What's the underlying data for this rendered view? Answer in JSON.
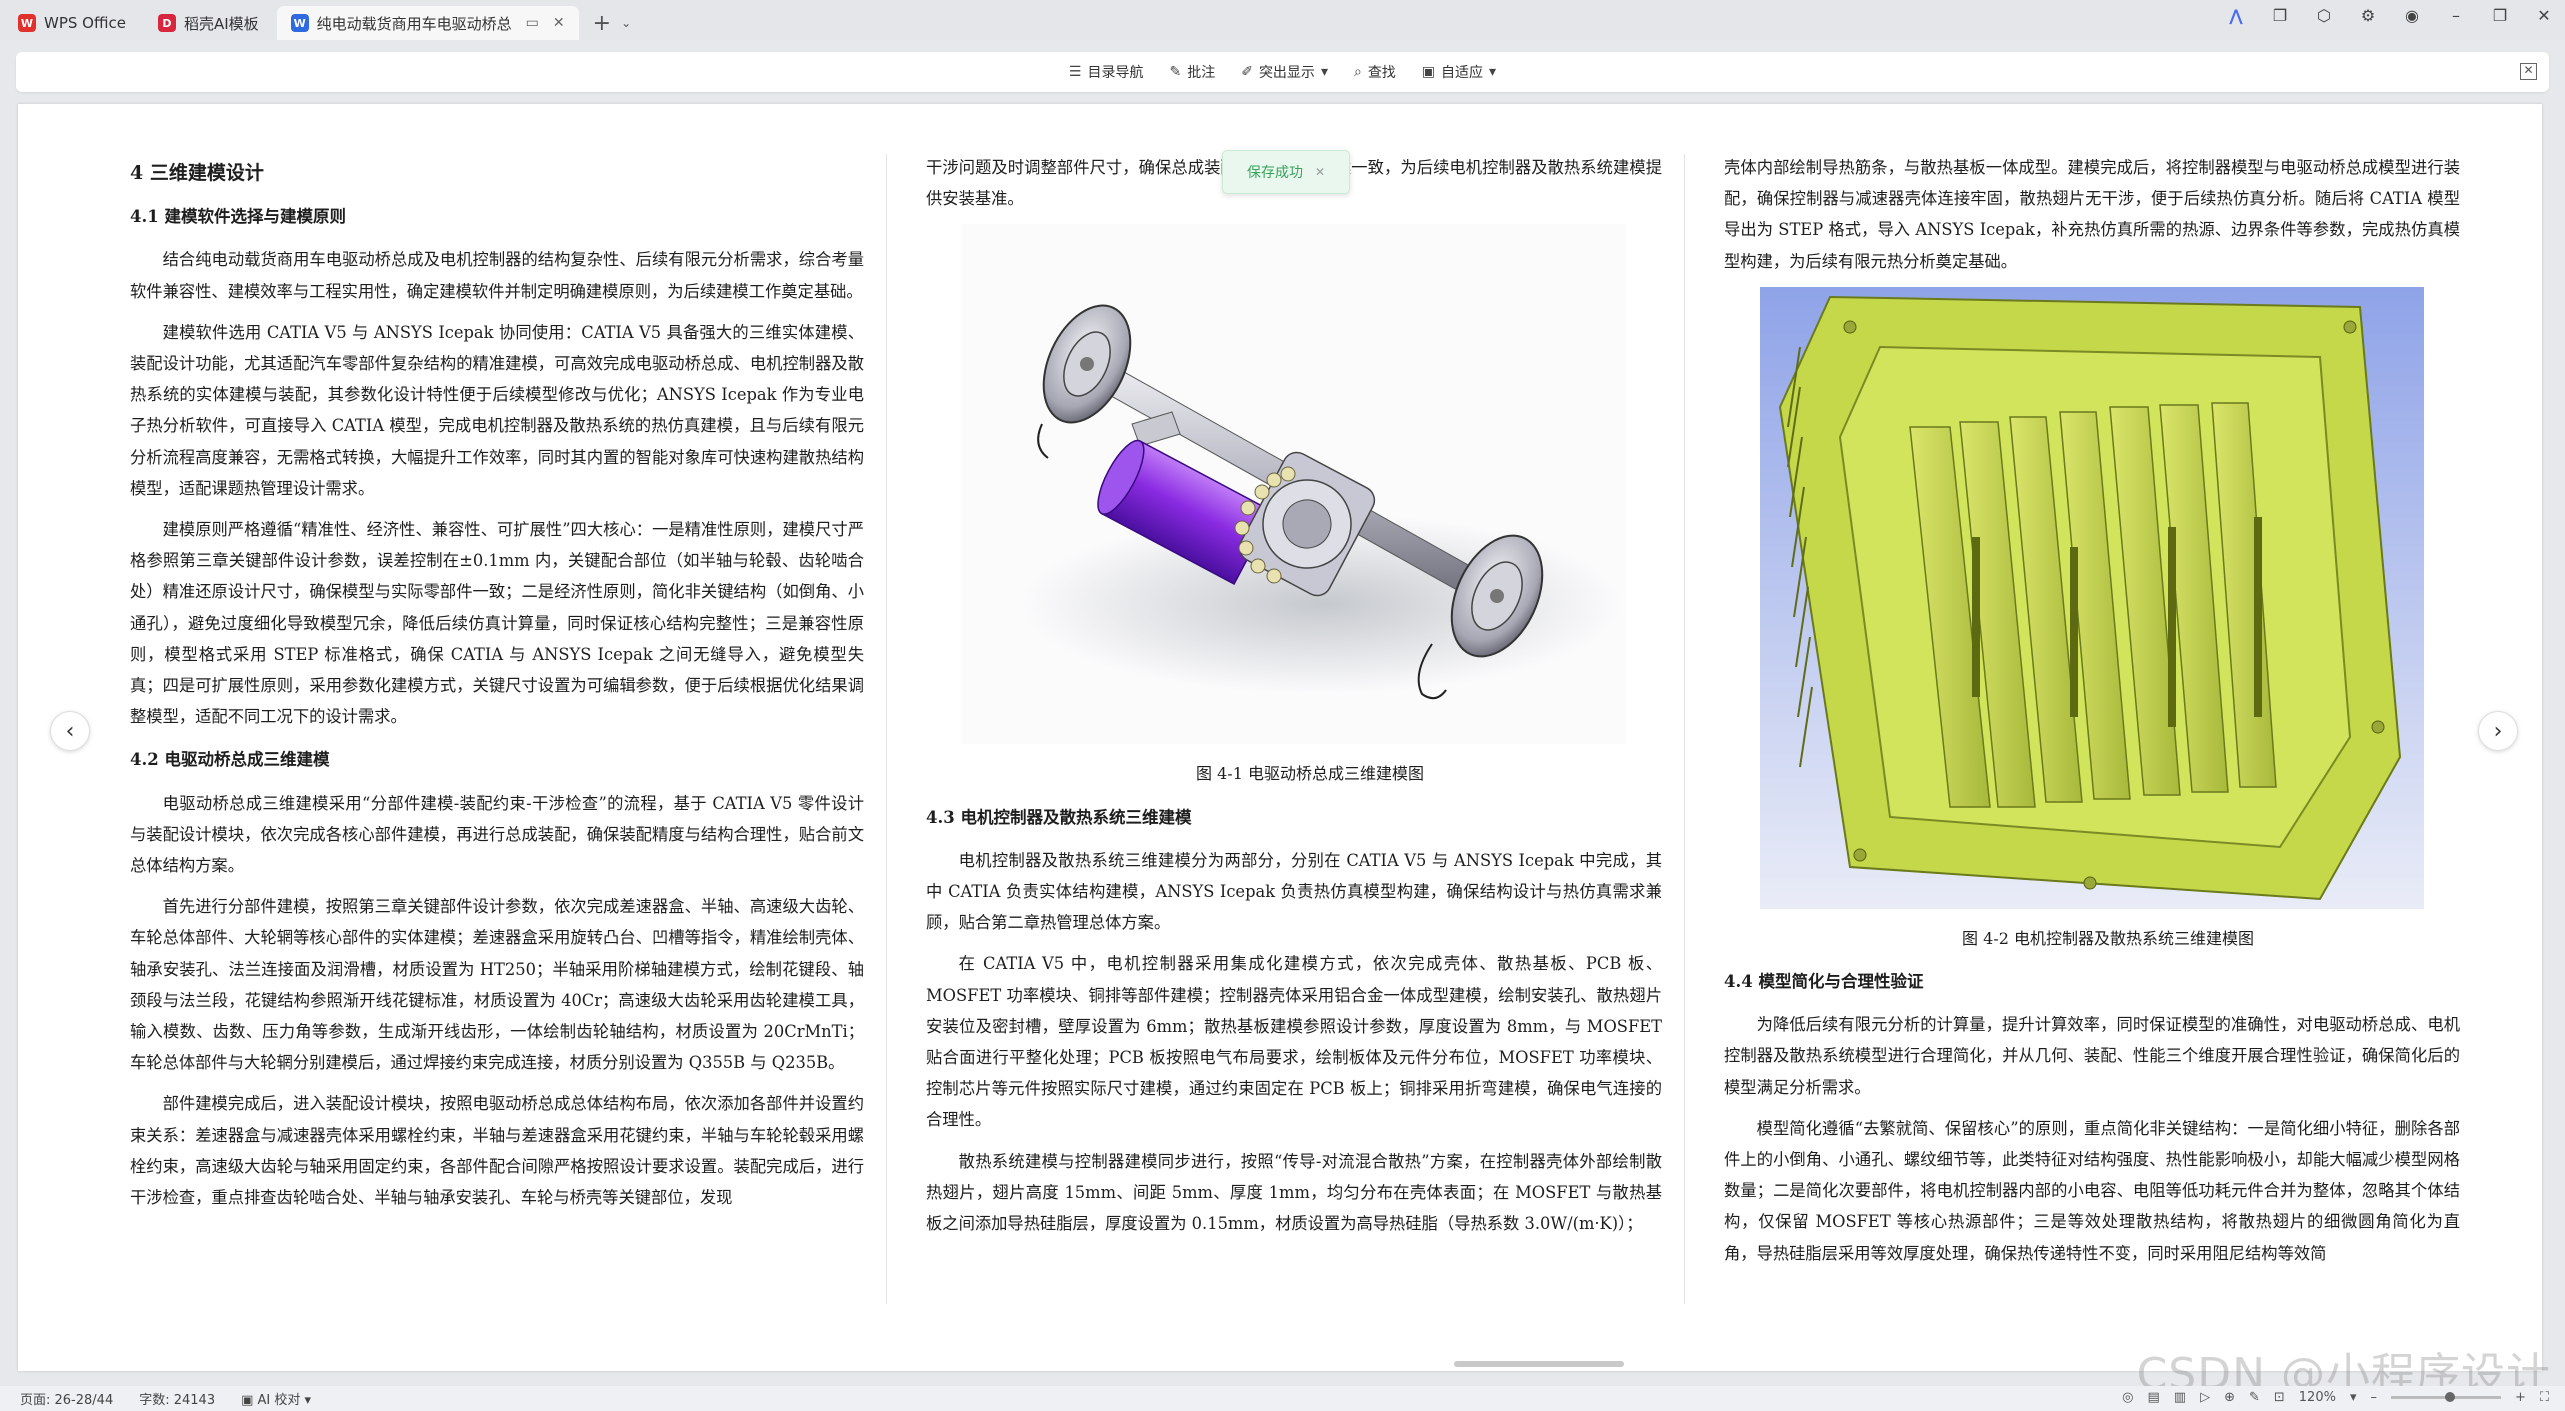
{
  "tabs": [
    {
      "label": "WPS Office",
      "icon": "wps-logo-icon"
    },
    {
      "label": "稻壳AI模板",
      "icon": "docer-icon"
    },
    {
      "label": "纯电动载货商用车电驱动桥总",
      "icon": "writer-doc-icon"
    }
  ],
  "toolbar": {
    "nav_label": "目录导航",
    "comment_label": "批注",
    "highlight_label": "突出显示",
    "find_label": "查找",
    "fit_label": "自适应"
  },
  "toast": {
    "text": "保存成功"
  },
  "doc": {
    "col1": {
      "h_4": "4  三维建模设计",
      "h_41": "4.1  建模软件选择与建模原则",
      "p1": "结合纯电动载货商用车电驱动桥总成及电机控制器的结构复杂性、后续有限元分析需求，综合考量软件兼容性、建模效率与工程实用性，确定建模软件并制定明确建模原则，为后续建模工作奠定基础。",
      "p2": "建模软件选用 CATIA V5 与 ANSYS Icepak 协同使用：CATIA V5 具备强大的三维实体建模、装配设计功能，尤其适配汽车零部件复杂结构的精准建模，可高效完成电驱动桥总成、电机控制器及散热系统的实体建模与装配，其参数化设计特性便于后续模型修改与优化；ANSYS Icepak 作为专业电子热分析软件，可直接导入 CATIA 模型，完成电机控制器及散热系统的热仿真建模，且与后续有限元分析流程高度兼容，无需格式转换，大幅提升工作效率，同时其内置的智能对象库可快速构建散热结构模型，适配课题热管理设计需求。",
      "p3": "建模原则严格遵循“精准性、经济性、兼容性、可扩展性”四大核心：一是精准性原则，建模尺寸严格参照第三章关键部件设计参数，误差控制在±0.1mm 内，关键配合部位（如半轴与轮毂、齿轮啮合处）精准还原设计尺寸，确保模型与实际零部件一致；二是经济性原则，简化非关键结构（如倒角、小通孔），避免过度细化导致模型冗余，降低后续仿真计算量，同时保证核心结构完整性；三是兼容性原则，模型格式采用 STEP 标准格式，确保 CATIA 与 ANSYS Icepak 之间无缝导入，避免模型失真；四是可扩展性原则，采用参数化建模方式，关键尺寸设置为可编辑参数，便于后续根据优化结果调整模型，适配不同工况下的设计需求。",
      "h_42": "4.2  电驱动桥总成三维建模",
      "p4": "电驱动桥总成三维建模采用“分部件建模-装配约束-干涉检查”的流程，基于 CATIA V5 零件设计与装配设计模块，依次完成各核心部件建模，再进行总成装配，确保装配精度与结构合理性，贴合前文总体结构方案。",
      "p5": "首先进行分部件建模，按照第三章关键部件设计参数，依次完成差速器盒、半轴、高速级大齿轮、车轮总体部件、大轮辋等核心部件的实体建模；差速器盒采用旋转凸台、凹槽等指令，精准绘制壳体、轴承安装孔、法兰连接面及润滑槽，材质设置为 HT250；半轴采用阶梯轴建模方式，绘制花键段、轴颈段与法兰段，花键结构参照渐开线花键标准，材质设置为 40Cr；高速级大齿轮采用齿轮建模工具，输入模数、齿数、压力角等参数，生成渐开线齿形，一体绘制齿轮轴结构，材质设置为 20CrMnTi；车轮总体部件与大轮辋分别建模后，通过焊接约束完成连接，材质分别设置为 Q355B 与 Q235B。",
      "p6": "部件建模完成后，进入装配设计模块，按照电驱动桥总成总体结构布局，依次添加各部件并设置约束关系：差速器盒与减速器壳体采用螺栓约束，半轴与差速器盒采用花键约束，半轴与车轮轮毂采用螺栓约束，高速级大齿轮与轴采用固定约束，各部件配合间隙严格按照设计要求设置。装配完成后，进行干涉检查，重点排查齿轮啮合处、半轴与轴承安装孔、车轮与桥壳等关键部位，发现"
    },
    "col2": {
      "p0": "干涉问题及时调整部件尺寸，确保总成装配结构与设计方案一致，为后续电机控制器及散热系统建模提供安装基准。",
      "fig1_caption": "图 4-1  电驱动桥总成三维建模图",
      "h_43": "4.3  电机控制器及散热系统三维建模",
      "p1": "电机控制器及散热系统三维建模分为两部分，分别在 CATIA V5 与 ANSYS Icepak 中完成，其中 CATIA 负责实体结构建模，ANSYS Icepak 负责热仿真模型构建，确保结构设计与热仿真需求兼顾，贴合第二章热管理总体方案。",
      "p2": "在 CATIA V5 中，电机控制器采用集成化建模方式，依次完成壳体、散热基板、PCB 板、MOSFET 功率模块、铜排等部件建模；控制器壳体采用铝合金一体成型建模，绘制安装孔、散热翅片安装位及密封槽，壁厚设置为 6mm；散热基板建模参照设计参数，厚度设置为 8mm，与 MOSFET 贴合面进行平整化处理；PCB 板按照电气布局要求，绘制板体及元件分布位，MOSFET 功率模块、控制芯片等元件按照实际尺寸建模，通过约束固定在 PCB 板上；铜排采用折弯建模，确保电气连接的合理性。",
      "p3": "散热系统建模与控制器建模同步进行，按照“传导-对流混合散热”方案，在控制器壳体外部绘制散热翅片，翅片高度 15mm、间距 5mm、厚度 1mm，均匀分布在壳体表面；在 MOSFET 与散热基板之间添加导热硅脂层，厚度设置为 0.15mm，材质设置为高导热硅脂（导热系数 3.0W/(m·K)）；"
    },
    "col3": {
      "p0": "壳体内部绘制导热筋条，与散热基板一体成型。建模完成后，将控制器模型与电驱动桥总成模型进行装配，确保控制器与减速器壳体连接牢固，散热翅片无干涉，便于后续热仿真分析。随后将 CATIA 模型导出为 STEP 格式，导入 ANSYS Icepak，补充热仿真所需的热源、边界条件等参数，完成热仿真模型构建，为后续有限元热分析奠定基础。",
      "fig2_caption": "图 4-2  电机控制器及散热系统三维建模图",
      "h_44": "4.4  模型简化与合理性验证",
      "p1": "为降低后续有限元分析的计算量，提升计算效率，同时保证模型的准确性，对电驱动桥总成、电机控制器及散热系统模型进行合理简化，并从几何、装配、性能三个维度开展合理性验证，确保简化后的模型满足分析需求。",
      "p2": "模型简化遵循“去繁就简、保留核心”的原则，重点简化非关键结构：一是简化细小特征，删除各部件上的小倒角、小通孔、螺纹细节等，此类特征对结构强度、热性能影响极小，却能大幅减少模型网格数量；二是简化次要部件，将电机控制器内部的小电容、电阻等低功耗元件合并为整体，忽略其个体结构，仅保留 MOSFET 等核心热源部件；三是等效处理散热结构，将散热翅片的细微圆角简化为直角，导热硅脂层采用等效厚度处理，确保热传递特性不变，同时采用阻尼结构等效简"
    }
  },
  "status": {
    "page": "页面: 26-28/44",
    "words": "字数: 24143",
    "ai_check": "AI 校对",
    "zoom": "120%"
  },
  "watermark": "CSDN @小程序设计",
  "colors": {
    "motor_purple": "#8a2be2",
    "heatsink_green": "#c4d84a",
    "toast_green": "#37a35c",
    "doc_accent": "#2f6ae0"
  }
}
